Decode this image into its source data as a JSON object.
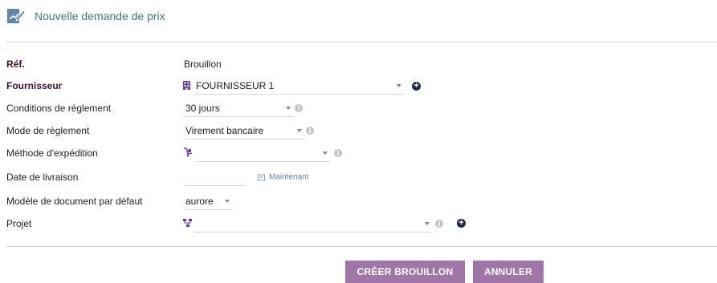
{
  "header": {
    "title": "Nouvelle demande de prix",
    "icon": "document-edit-icon"
  },
  "form": {
    "ref": {
      "label": "Réf.",
      "value": "Brouillon"
    },
    "supplier": {
      "label": "Fournisseur",
      "value": "FOURNISSEUR 1",
      "icon": "building-icon"
    },
    "payment_terms": {
      "label": "Conditions de règlement",
      "value": "30 jours"
    },
    "payment_mode": {
      "label": "Mode de règlement",
      "value": "Virement bancaire"
    },
    "shipping_method": {
      "label": "Méthode d'expédition",
      "value": "",
      "icon": "dolly-icon"
    },
    "delivery_date": {
      "label": "Date de livraison",
      "value": "",
      "now_label": "Maintenant"
    },
    "default_template": {
      "label": "Modèle de document par défaut",
      "value": "aurore"
    },
    "project": {
      "label": "Projet",
      "value": "",
      "icon": "project-tree-icon"
    }
  },
  "actions": {
    "create_label": "CRÉER BROUILLON",
    "cancel_label": "ANNULER"
  },
  "colors": {
    "accent": "#a076a8",
    "title": "#3b7a7b",
    "label_bold": "#3a0f3a",
    "icon_purple": "#6a3fa0"
  }
}
